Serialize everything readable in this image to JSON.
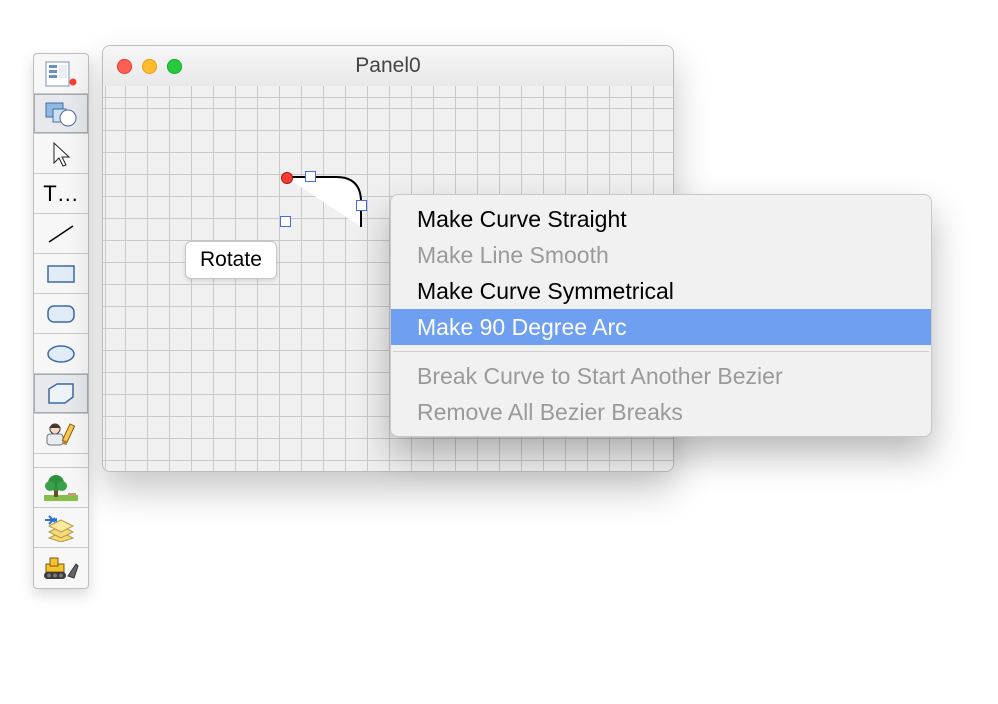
{
  "window": {
    "title": "Panel0"
  },
  "tooltip": {
    "label": "Rotate"
  },
  "toolPalette": {
    "textToolLabel": "T…"
  },
  "contextMenu": {
    "items": [
      {
        "label": "Make Curve Straight",
        "enabled": true,
        "highlighted": false
      },
      {
        "label": "Make Line Smooth",
        "enabled": false,
        "highlighted": false
      },
      {
        "label": "Make Curve Symmetrical",
        "enabled": true,
        "highlighted": false
      },
      {
        "label": "Make 90 Degree Arc",
        "enabled": true,
        "highlighted": true
      },
      {
        "separator": true
      },
      {
        "label": "Break Curve to Start Another Bezier",
        "enabled": false,
        "highlighted": false
      },
      {
        "label": "Remove All Bezier Breaks",
        "enabled": false,
        "highlighted": false
      }
    ]
  }
}
